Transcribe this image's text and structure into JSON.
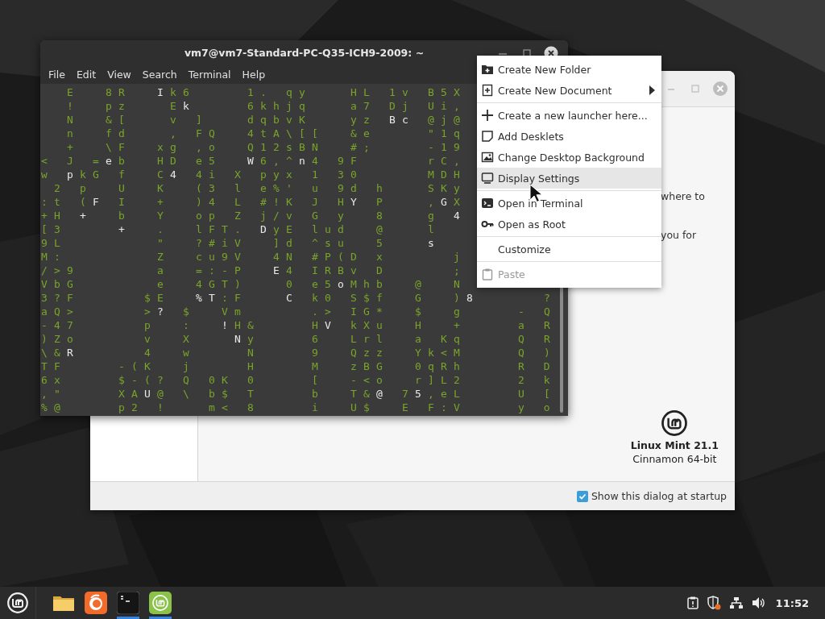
{
  "terminal": {
    "title": "vm7@vm7-Standard-PC-Q35-ICH9-2009: ~",
    "menu": [
      "File",
      "Edit",
      "View",
      "Search",
      "Terminal",
      "Help"
    ],
    "lines": [
      [
        {
          "text": "  E  8R  ",
          "kind": "trail"
        },
        {
          "text": "I",
          "kind": "head"
        },
        {
          "text": "k6    1. qy   HL 1v B5X",
          "kind": "trail"
        }
      ],
      [
        {
          "text": "  !  pz   E",
          "kind": "trail"
        },
        {
          "text": "k",
          "kind": "head"
        },
        {
          "text": "    6khjq   a7 Dj Ui,",
          "kind": "trail"
        }
      ],
      [
        {
          "text": "  N  &[   v ]   dqbvK   yz ",
          "kind": "trail"
        },
        {
          "text": "Bc",
          "kind": "head"
        },
        {
          "text": " @j@",
          "kind": "trail"
        }
      ],
      [
        {
          "text": "  n  fd   , FQ  4tA\\[[  &e    \"1q",
          "kind": "trail"
        }
      ],
      [
        {
          "text": "  +  \\F  xg ,o  Q12sBN  #;    -19",
          "kind": "trail"
        }
      ],
      [
        {
          "text": "< J =",
          "kind": "trail"
        },
        {
          "text": "e",
          "kind": "head"
        },
        {
          "text": "b  HD e5  ",
          "kind": "trail"
        },
        {
          "text": "W",
          "kind": "head"
        },
        {
          "text": "6,^",
          "kind": "trail"
        },
        {
          "text": "n",
          "kind": "head"
        },
        {
          "text": "4 9F     rC,",
          "kind": "trail"
        }
      ],
      [
        {
          "text": "w ",
          "kind": "trail"
        },
        {
          "text": "p",
          "kind": "head"
        },
        {
          "text": "kG f  C",
          "kind": "trail"
        },
        {
          "text": "4",
          "kind": "head"
        },
        {
          "text": " 4i X pyx 1 30     MDH",
          "kind": "trail"
        }
      ],
      [
        {
          "text": " 2 p  U  K  (3 l e%' u 9d h   SKy",
          "kind": "trail"
        }
      ],
      [
        {
          "text": ":t (",
          "kind": "trail"
        },
        {
          "text": "F",
          "kind": "head"
        },
        {
          "text": " I  +  )4 L #!K J H",
          "kind": "trail"
        },
        {
          "text": "Y",
          "kind": "head"
        },
        {
          "text": " P   ,",
          "kind": "trail"
        },
        {
          "text": "G",
          "kind": "head"
        },
        {
          "text": "X",
          "kind": "trail"
        }
      ],
      [
        {
          "text": "+H ",
          "kind": "trail"
        },
        {
          "text": "+",
          "kind": "head"
        },
        {
          "text": "  b  Y  op Z j/v G y  8   g ",
          "kind": "trail"
        },
        {
          "text": "4",
          "kind": "head"
        }
      ],
      [
        {
          "text": "[3    ",
          "kind": "trail"
        },
        {
          "text": "+",
          "kind": "head"
        },
        {
          "text": "  .  lFT. ",
          "kind": "trail"
        },
        {
          "text": "D",
          "kind": "head"
        },
        {
          "text": "yE lud  @   l",
          "kind": "trail"
        }
      ],
      [
        {
          "text": "9L       \"  ?#iV  ]d ^su  5   ",
          "kind": "trail"
        },
        {
          "text": "s",
          "kind": "head"
        }
      ],
      [
        {
          "text": "M:       Z  cu9V  4N #P(D x     j",
          "kind": "trail"
        }
      ],
      [
        {
          "text": "/>9      a  =:-P  ",
          "kind": "trail"
        },
        {
          "text": "E",
          "kind": "head"
        },
        {
          "text": "4 IRBv D     ;",
          "kind": "trail"
        }
      ],
      [
        {
          "text": "VbG      e  4GT)   0 e5",
          "kind": "trail"
        },
        {
          "text": "o",
          "kind": "head"
        },
        {
          "text": "Mhb  @  N",
          "kind": "trail"
        }
      ],
      [
        {
          "text": "3?F     $E  ",
          "kind": "trail"
        },
        {
          "text": "%T",
          "kind": "head"
        },
        {
          "text": ":F   ",
          "kind": "trail"
        },
        {
          "text": "C",
          "kind": "head"
        },
        {
          "text": " k0 S$f  G  )",
          "kind": "trail"
        },
        {
          "text": "8",
          "kind": "head"
        },
        {
          "text": "     ?",
          "kind": "trail"
        }
      ],
      [
        {
          "text": "aQ>     >",
          "kind": "trail"
        },
        {
          "text": "?",
          "kind": "head"
        },
        {
          "text": " $  Vm     .> IG*  $  g    - Q",
          "kind": "trail"
        }
      ],
      [
        {
          "text": "-47     p  :  ",
          "kind": "trail"
        },
        {
          "text": "!",
          "kind": "head"
        },
        {
          "text": "H&    H",
          "kind": "trail"
        },
        {
          "text": "V",
          "kind": "head"
        },
        {
          "text": " kXu  H  +    a R",
          "kind": "trail"
        }
      ],
      [
        {
          "text": ")Zo     v  X   ",
          "kind": "trail"
        },
        {
          "text": "N",
          "kind": "head"
        },
        {
          "text": "y    6  Lrl  a Kq    Q R",
          "kind": "trail"
        }
      ],
      [
        {
          "text": "\\&",
          "kind": "trail"
        },
        {
          "text": "R",
          "kind": "head"
        },
        {
          "text": "     4  w    N    9  Qzz  Yk<M    Q )",
          "kind": "trail"
        }
      ],
      [
        {
          "text": "TF    -(K  j    H    M  zBG  0qRh    R D",
          "kind": "trail"
        }
      ],
      [
        {
          "text": "6x    $-(? Q 0K 0    [  -<o  r]L2    2 k",
          "kind": "trail"
        }
      ],
      [
        {
          "text": ",\"    XA",
          "kind": "trail"
        },
        {
          "text": "U",
          "kind": "head"
        },
        {
          "text": "@ \\ b$ T    b  T&",
          "kind": "trail"
        },
        {
          "text": "@",
          "kind": "head"
        },
        {
          "text": " 7",
          "kind": "trail"
        },
        {
          "text": "5",
          "kind": "head"
        },
        {
          "text": ",eL    U [",
          "kind": "trail"
        }
      ],
      [
        {
          "text": "%@    p2 !   m< 8    i  U$  E F:V    y o",
          "kind": "trail"
        }
      ]
    ]
  },
  "welcome": {
    "text_fragments": [
      "where to",
      "you for"
    ],
    "product_name": "Linux Mint 21.1",
    "edition": "Cinnamon 64-bit",
    "startup_checkbox": {
      "label": "Show this dialog at startup",
      "checked": true
    }
  },
  "context_menu": {
    "groups": [
      [
        {
          "label": "Create New Folder",
          "selected": false,
          "disabled": false,
          "submenu": false
        },
        {
          "label": "Create New Document",
          "selected": false,
          "disabled": false,
          "submenu": true
        }
      ],
      [
        {
          "label": "Create a new launcher here...",
          "selected": false,
          "disabled": false,
          "submenu": false
        },
        {
          "label": "Add Desklets",
          "selected": false,
          "disabled": false,
          "submenu": false
        },
        {
          "label": "Change Desktop Background",
          "selected": false,
          "disabled": false,
          "submenu": false
        },
        {
          "label": "Display Settings",
          "selected": true,
          "disabled": false,
          "submenu": false
        }
      ],
      [
        {
          "label": "Open in Terminal",
          "selected": false,
          "disabled": false,
          "submenu": false
        },
        {
          "label": "Open as Root",
          "selected": false,
          "disabled": false,
          "submenu": false
        }
      ],
      [
        {
          "label": "Customize",
          "selected": false,
          "disabled": false,
          "submenu": false
        }
      ],
      [
        {
          "label": "Paste",
          "selected": false,
          "disabled": true,
          "submenu": false
        }
      ]
    ]
  },
  "taskbar": {
    "launchers": [
      {
        "running": false
      },
      {
        "running": false
      },
      {
        "running": true
      },
      {
        "running": true
      }
    ],
    "clock": "11:52"
  }
}
